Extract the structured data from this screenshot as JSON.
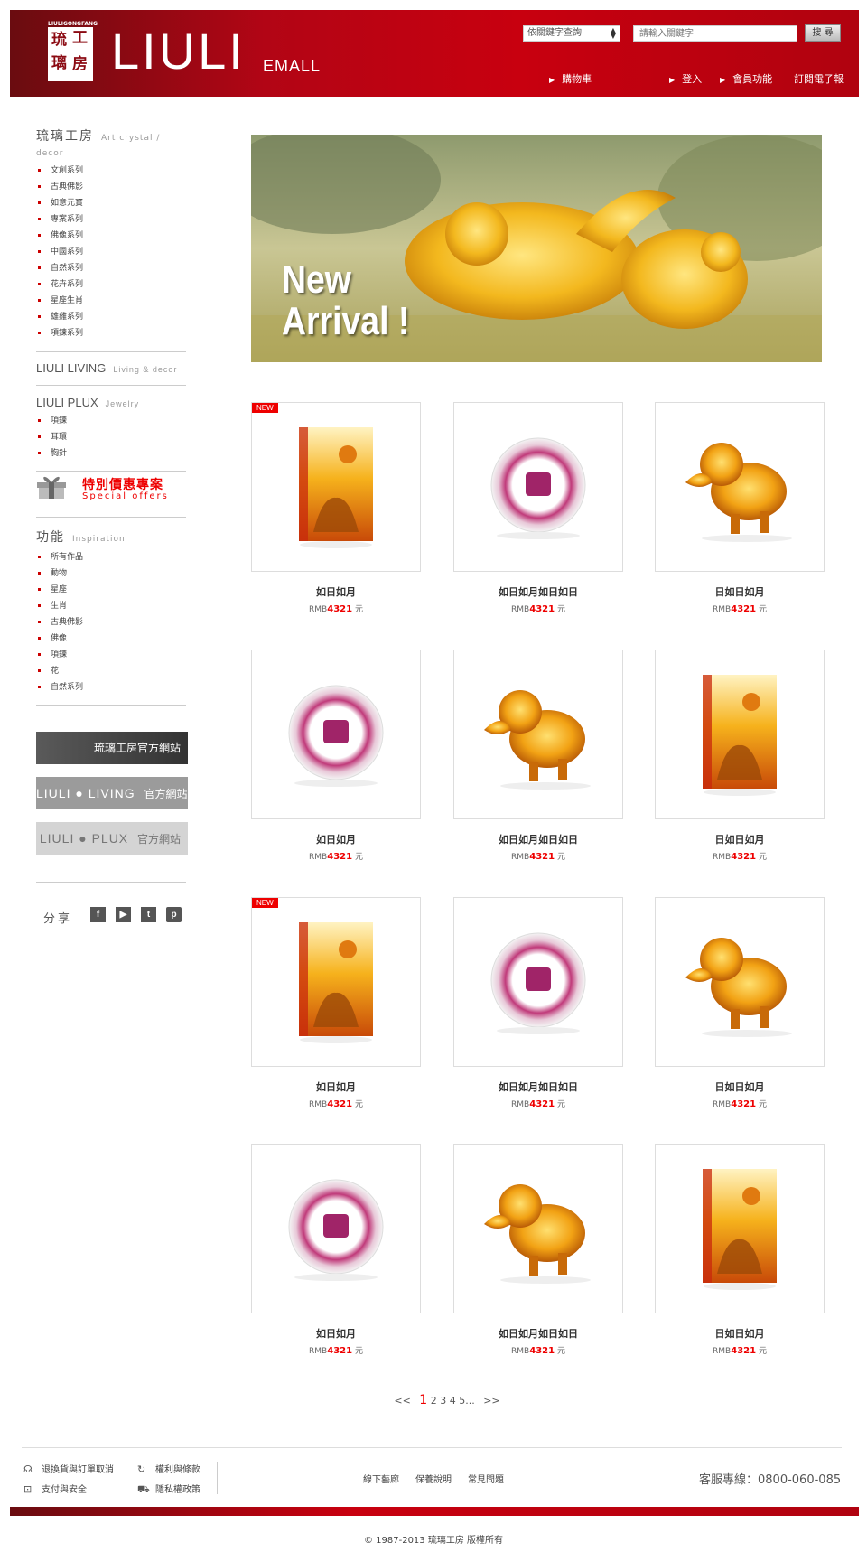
{
  "header": {
    "logo_small": "LIULIGONGFANG",
    "logo_chars": [
      "琉",
      "工",
      "璃",
      "房"
    ],
    "brand": "LIULI",
    "brand_sub": "EMALL",
    "search_select": "依關鍵字查詢",
    "search_placeholder": "請輸入關鍵字",
    "search_button": "搜 尋",
    "nav": {
      "cart": "購物車",
      "login": "登入",
      "member": "會員功能",
      "newsletter": "訂閱電子報"
    }
  },
  "sidebar": {
    "art": {
      "title": "琉璃工房",
      "en": "Art crystal / decor",
      "items": [
        "文創系列",
        "古典佛影",
        "如意元寶",
        "專案系列",
        "佛像系列",
        "中國系列",
        "自然系列",
        "花卉系列",
        "星座生肖",
        "雄雞系列",
        "項鍊系列"
      ]
    },
    "living": {
      "title": "LIULI LIVING",
      "en": "Living & decor"
    },
    "plux": {
      "title": "LIULI PLUX",
      "en": "Jewelry",
      "items": [
        "項鍊",
        "耳環",
        "胸針"
      ]
    },
    "special": {
      "cn": "特別價惠專案",
      "en": "Special offers"
    },
    "function": {
      "title": "功能",
      "en": "Inspiration",
      "items": [
        "所有作品",
        "動物",
        "星座",
        "生肖",
        "古典佛影",
        "佛像",
        "項鍊",
        "花",
        "自然系列"
      ]
    },
    "sites": [
      {
        "text": "琉璃工房官方網站"
      },
      {
        "text": "LIULI ● LIVING",
        "suffix": "官方網站"
      },
      {
        "text": "LIULI ● PLUX",
        "suffix": "官方網站"
      }
    ],
    "share": "分享",
    "social": [
      "f",
      "▶",
      "t",
      "p"
    ]
  },
  "banner": {
    "line1": "New",
    "line2": "Arrival !"
  },
  "products": [
    {
      "name": "如日如月",
      "currency": "RMB",
      "price": "4321",
      "unit": "元",
      "badge": "NEW",
      "kind": "block"
    },
    {
      "name": "如日如月如日如日",
      "currency": "RMB",
      "price": "4321",
      "unit": "元",
      "badge": "",
      "kind": "ring"
    },
    {
      "name": "日如日如月",
      "currency": "RMB",
      "price": "4321",
      "unit": "元",
      "badge": "",
      "kind": "beast"
    },
    {
      "name": "如日如月",
      "currency": "RMB",
      "price": "4321",
      "unit": "元",
      "badge": "",
      "kind": "ring"
    },
    {
      "name": "如日如月如日如日",
      "currency": "RMB",
      "price": "4321",
      "unit": "元",
      "badge": "",
      "kind": "beast"
    },
    {
      "name": "日如日如月",
      "currency": "RMB",
      "price": "4321",
      "unit": "元",
      "badge": "",
      "kind": "block"
    },
    {
      "name": "如日如月",
      "currency": "RMB",
      "price": "4321",
      "unit": "元",
      "badge": "NEW",
      "kind": "block"
    },
    {
      "name": "如日如月如日如日",
      "currency": "RMB",
      "price": "4321",
      "unit": "元",
      "badge": "",
      "kind": "ring"
    },
    {
      "name": "日如日如月",
      "currency": "RMB",
      "price": "4321",
      "unit": "元",
      "badge": "",
      "kind": "beast"
    },
    {
      "name": "如日如月",
      "currency": "RMB",
      "price": "4321",
      "unit": "元",
      "badge": "",
      "kind": "ring"
    },
    {
      "name": "如日如月如日如日",
      "currency": "RMB",
      "price": "4321",
      "unit": "元",
      "badge": "",
      "kind": "beast"
    },
    {
      "name": "日如日如月",
      "currency": "RMB",
      "price": "4321",
      "unit": "元",
      "badge": "",
      "kind": "block"
    }
  ],
  "pagination": {
    "prev": "<<",
    "current": "1",
    "pages": "2 3 4 5",
    "ellipsis": "...",
    "next": ">>"
  },
  "footer": {
    "return": "退換貨與訂單取消",
    "payment": "支付與安全",
    "rights": "權利與條款",
    "privacy": "隱私權政策",
    "stores": "線下藝廊",
    "care": "保養說明",
    "faq": "常見問題",
    "hotline_label": "客服專線：",
    "hotline": "0800-060-085",
    "copyright": "©  1987-2013  琉璃工房  版權所有"
  },
  "colors": {
    "brand_red": "#c8000f",
    "price_red": "#e00000"
  }
}
